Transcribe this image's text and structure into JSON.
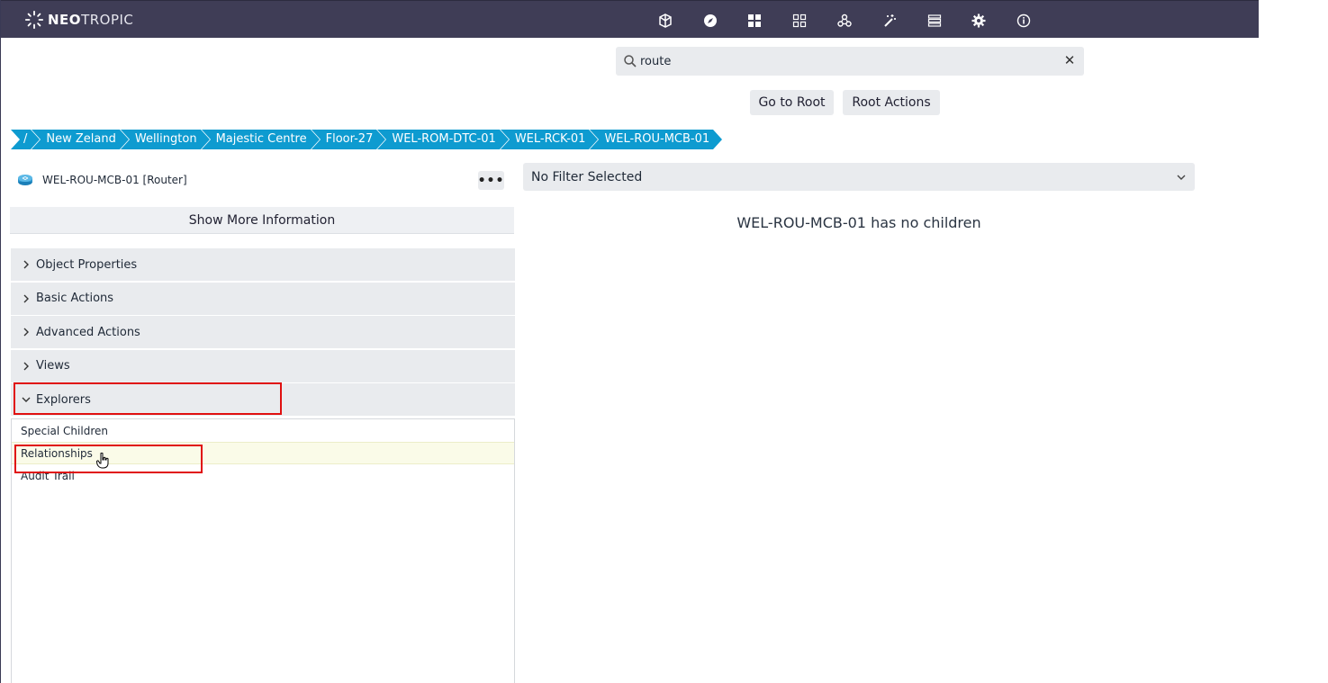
{
  "app": {
    "logo_bold": "NEO",
    "logo_light": "TROPIC"
  },
  "nav_icons": [
    "cube-icon",
    "compass-icon",
    "dashboard-icon",
    "grid-icon",
    "network-icon",
    "magic-wand-icon",
    "list-icon",
    "gear-icon",
    "info-icon"
  ],
  "search": {
    "value": "route",
    "placeholder": ""
  },
  "buttons": {
    "go_to_root": "Go to Root",
    "root_actions": "Root Actions"
  },
  "breadcrumb": [
    "/",
    "New Zeland",
    "Wellington",
    "Majestic Centre",
    "Floor-27",
    "WEL-ROM-DTC-01",
    "WEL-RCK-01",
    "WEL-ROU-MCB-01"
  ],
  "object": {
    "title": "WEL-ROU-MCB-01 [Router]",
    "more_label": "•••",
    "show_more": "Show More Information"
  },
  "accordion": [
    "Object Properties",
    "Basic Actions",
    "Advanced Actions",
    "Views",
    "Explorers"
  ],
  "explorers": [
    "Special Children",
    "Relationships",
    "Audit Trail"
  ],
  "filter": {
    "selected": "No Filter Selected"
  },
  "main": {
    "empty_message": "WEL-ROU-MCB-01 has no children"
  },
  "colors": {
    "topbar": "#3f3d56",
    "breadcrumb": "#0e9bd0",
    "highlight": "#e01010"
  }
}
